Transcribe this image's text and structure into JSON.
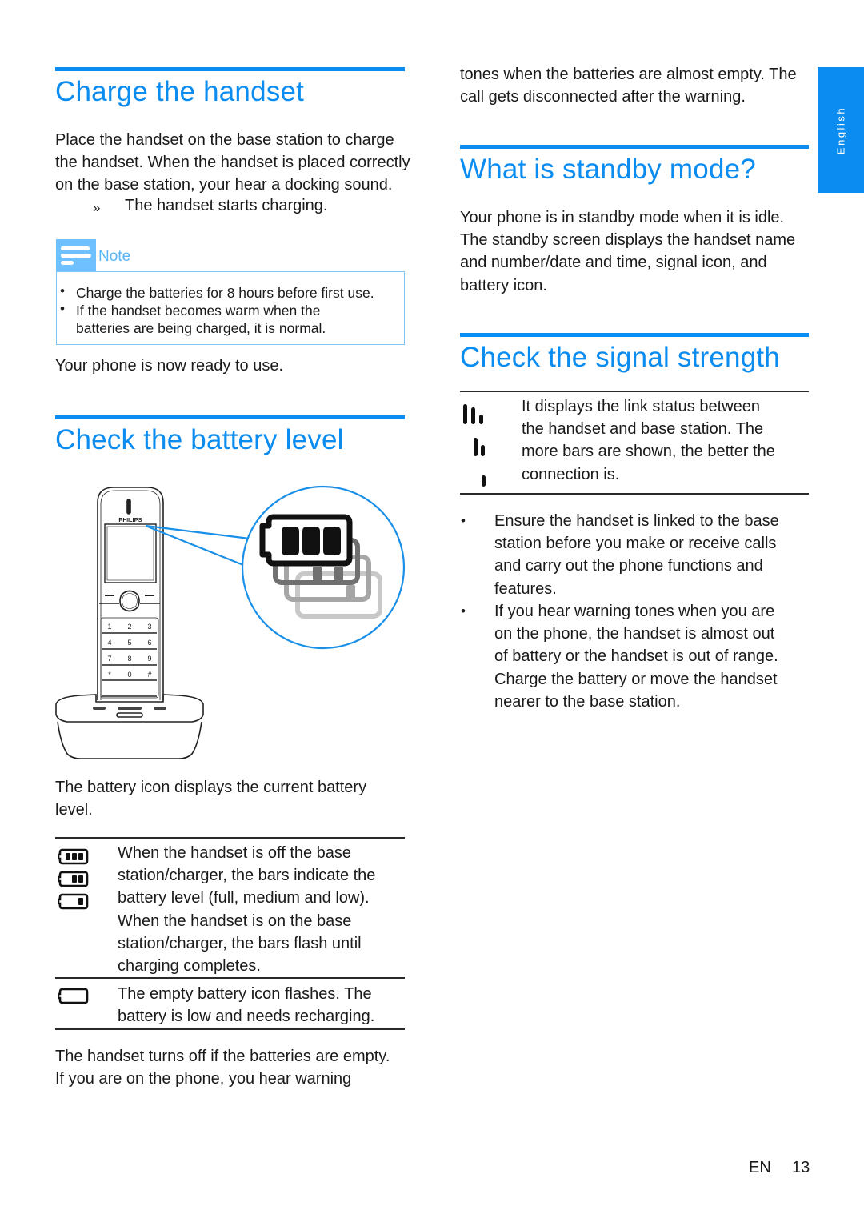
{
  "side_tab": {
    "label": "English"
  },
  "left_column": {
    "charge": {
      "title": "Charge the handset",
      "paragraph_lines": [
        "Place the handset on the base station to charge",
        "the handset. When the handset is placed correctly",
        "on the base station, your hear a docking sound."
      ],
      "result_marker": "»",
      "result_text": "The handset starts charging.",
      "note": {
        "label": "Note",
        "items": [
          [
            "Charge the batteries for 8 hours before first use."
          ],
          [
            "If the handset becomes warm when the",
            "batteries are being charged, it is normal."
          ]
        ]
      },
      "ready_text": "Your phone is now ready to use."
    },
    "battery": {
      "title": "Check the battery level",
      "illustration": {
        "brand": "PHILIPS",
        "keypad": [
          [
            "1",
            "2",
            "3"
          ],
          [
            "4",
            "5",
            "6"
          ],
          [
            "7",
            "8",
            "9"
          ],
          [
            "*",
            "0",
            "#"
          ]
        ]
      },
      "intro_lines": [
        "The battery icon displays the current battery",
        "level."
      ],
      "table": [
        {
          "icons": [
            "battery-full-icon",
            "battery-medium-icon",
            "battery-low-icon"
          ],
          "lines": [
            "When the handset is off the base",
            "station/charger, the bars indicate the",
            "battery level (full, medium and low).",
            "When the handset is on the base",
            "station/charger, the bars flash until",
            "charging completes."
          ]
        },
        {
          "icons": [
            "battery-empty-icon"
          ],
          "lines": [
            "The empty battery icon flashes. The",
            "battery is low and needs recharging."
          ]
        }
      ],
      "outro_lines": [
        "The handset turns off if the batteries are empty.",
        "If you are on the phone, you hear warning"
      ]
    }
  },
  "right_column": {
    "continued_lines": [
      "tones when the batteries are almost empty. The",
      "call gets disconnected after the warning."
    ],
    "standby": {
      "title": "What is standby mode?",
      "lines": [
        "Your phone is in standby mode when it is idle.",
        "The standby screen displays the handset name",
        "and number/date and time, signal icon, and",
        "battery icon."
      ]
    },
    "signal": {
      "title": "Check the signal strength",
      "table_lines": [
        "It displays the link status between",
        "the handset and base station. The",
        "more bars are shown, the better the",
        "connection is."
      ],
      "bullets": [
        {
          "marker": "•",
          "lines": [
            "Ensure the handset is linked to the base",
            "station before you make or receive calls",
            "and carry out the phone functions and",
            "features."
          ]
        },
        {
          "marker": "•",
          "lines": [
            "If you hear warning tones when you are",
            "on the phone, the handset is almost out",
            "of battery or the handset is out of range.",
            "Charge the battery or move the handset",
            "nearer to the base station."
          ]
        }
      ]
    }
  },
  "footer": {
    "lang": "EN",
    "page": "13"
  }
}
